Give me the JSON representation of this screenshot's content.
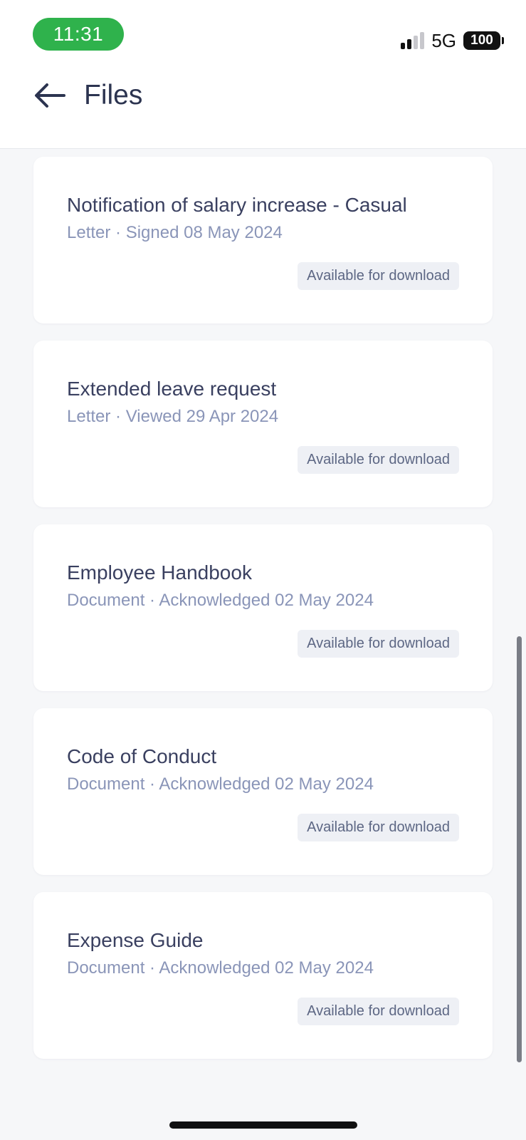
{
  "status_bar": {
    "time": "11:31",
    "network": "5G",
    "battery": "100",
    "time_pill_color": "#2fb24c"
  },
  "header": {
    "back_icon": "arrow-left-icon",
    "title": "Files"
  },
  "files": [
    {
      "title": "Notification of salary increase - Casual",
      "meta": "Letter · Signed 08 May 2024",
      "badge": "Available for download"
    },
    {
      "title": "Extended leave request",
      "meta": "Letter · Viewed 29 Apr 2024",
      "badge": "Available for download"
    },
    {
      "title": "Employee Handbook",
      "meta": "Document · Acknowledged 02 May 2024",
      "badge": "Available for download"
    },
    {
      "title": "Code of Conduct",
      "meta": "Document · Acknowledged 02 May 2024",
      "badge": "Available for download"
    },
    {
      "title": "Expense Guide",
      "meta": "Document · Acknowledged 02 May 2024",
      "badge": "Available for download"
    }
  ]
}
